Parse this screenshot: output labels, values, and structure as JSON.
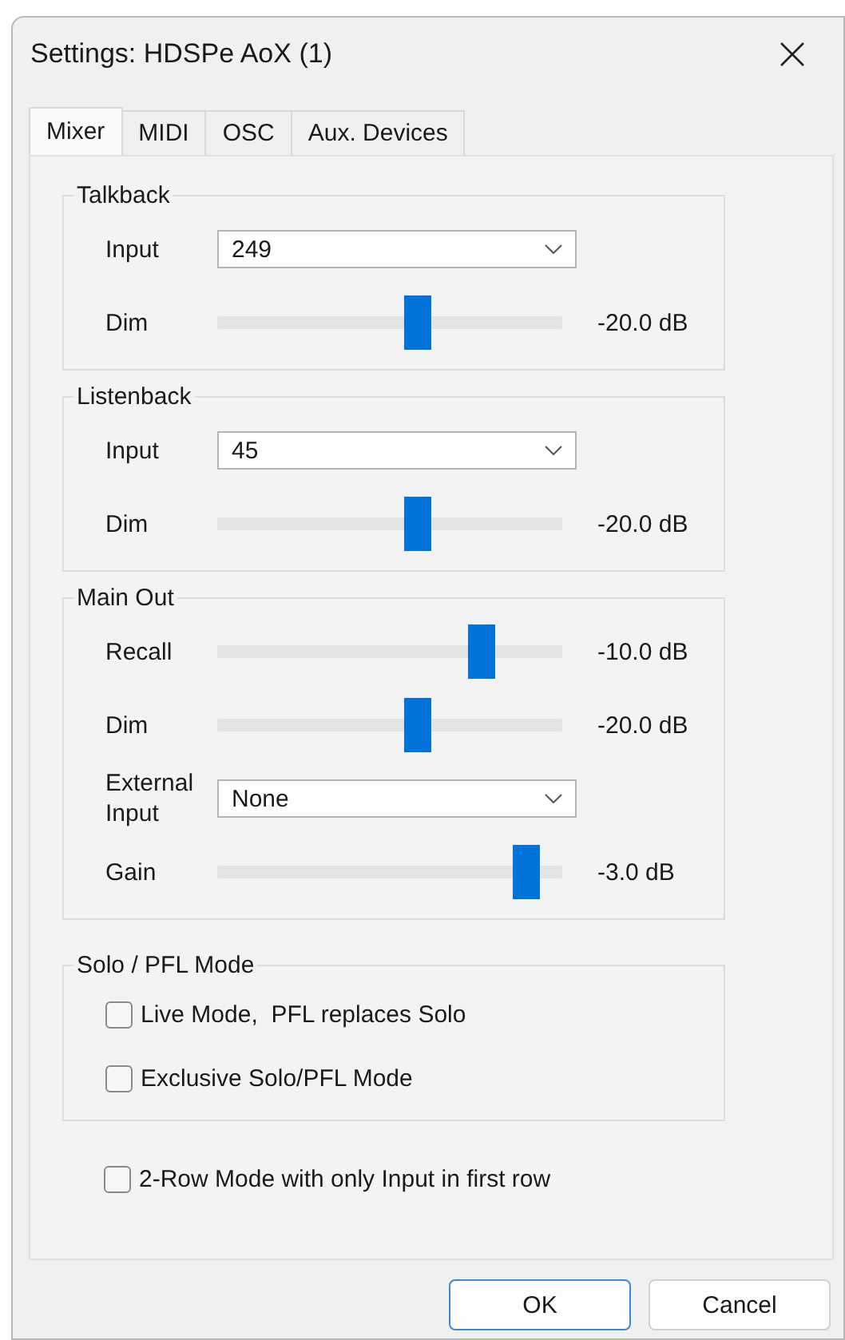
{
  "window": {
    "title": "Settings: HDSPe AoX (1)"
  },
  "tabs": [
    {
      "label": "Mixer",
      "selected": true
    },
    {
      "label": "MIDI",
      "selected": false
    },
    {
      "label": "OSC",
      "selected": false
    },
    {
      "label": "Aux. Devices",
      "selected": false
    }
  ],
  "groups": [
    {
      "title": "Talkback",
      "rows": [
        {
          "kind": "dropdown",
          "label": "Input",
          "value": "249"
        },
        {
          "kind": "slider",
          "label": "Dim",
          "level": 0.59,
          "reading": "-20.0 dB"
        }
      ]
    },
    {
      "title": "Listenback",
      "rows": [
        {
          "kind": "dropdown",
          "label": "Input",
          "value": "45"
        },
        {
          "kind": "slider",
          "label": "Dim",
          "level": 0.59,
          "reading": "-20.0 dB"
        }
      ]
    },
    {
      "title": "Main Out",
      "rows": [
        {
          "kind": "slider",
          "label": "Recall",
          "level": 0.79,
          "reading": "-10.0 dB"
        },
        {
          "kind": "slider",
          "label": "Dim",
          "level": 0.59,
          "reading": "-20.0 dB"
        },
        {
          "kind": "dropdown",
          "label": "External Input",
          "value": "None"
        },
        {
          "kind": "slider",
          "label": "Gain",
          "level": 0.93,
          "reading": "-3.0 dB"
        }
      ]
    }
  ],
  "solo_group": {
    "title": "Solo / PFL Mode",
    "options": [
      {
        "label": "Live Mode,  PFL replaces Solo",
        "checked": false
      },
      {
        "label": "Exclusive Solo/PFL Mode",
        "checked": false
      }
    ]
  },
  "extra_option": {
    "label": "2-Row Mode with only Input in first row",
    "checked": false
  },
  "buttons": [
    {
      "label": "OK",
      "kind": "default"
    },
    {
      "label": "Cancel",
      "kind": "normal"
    }
  ]
}
